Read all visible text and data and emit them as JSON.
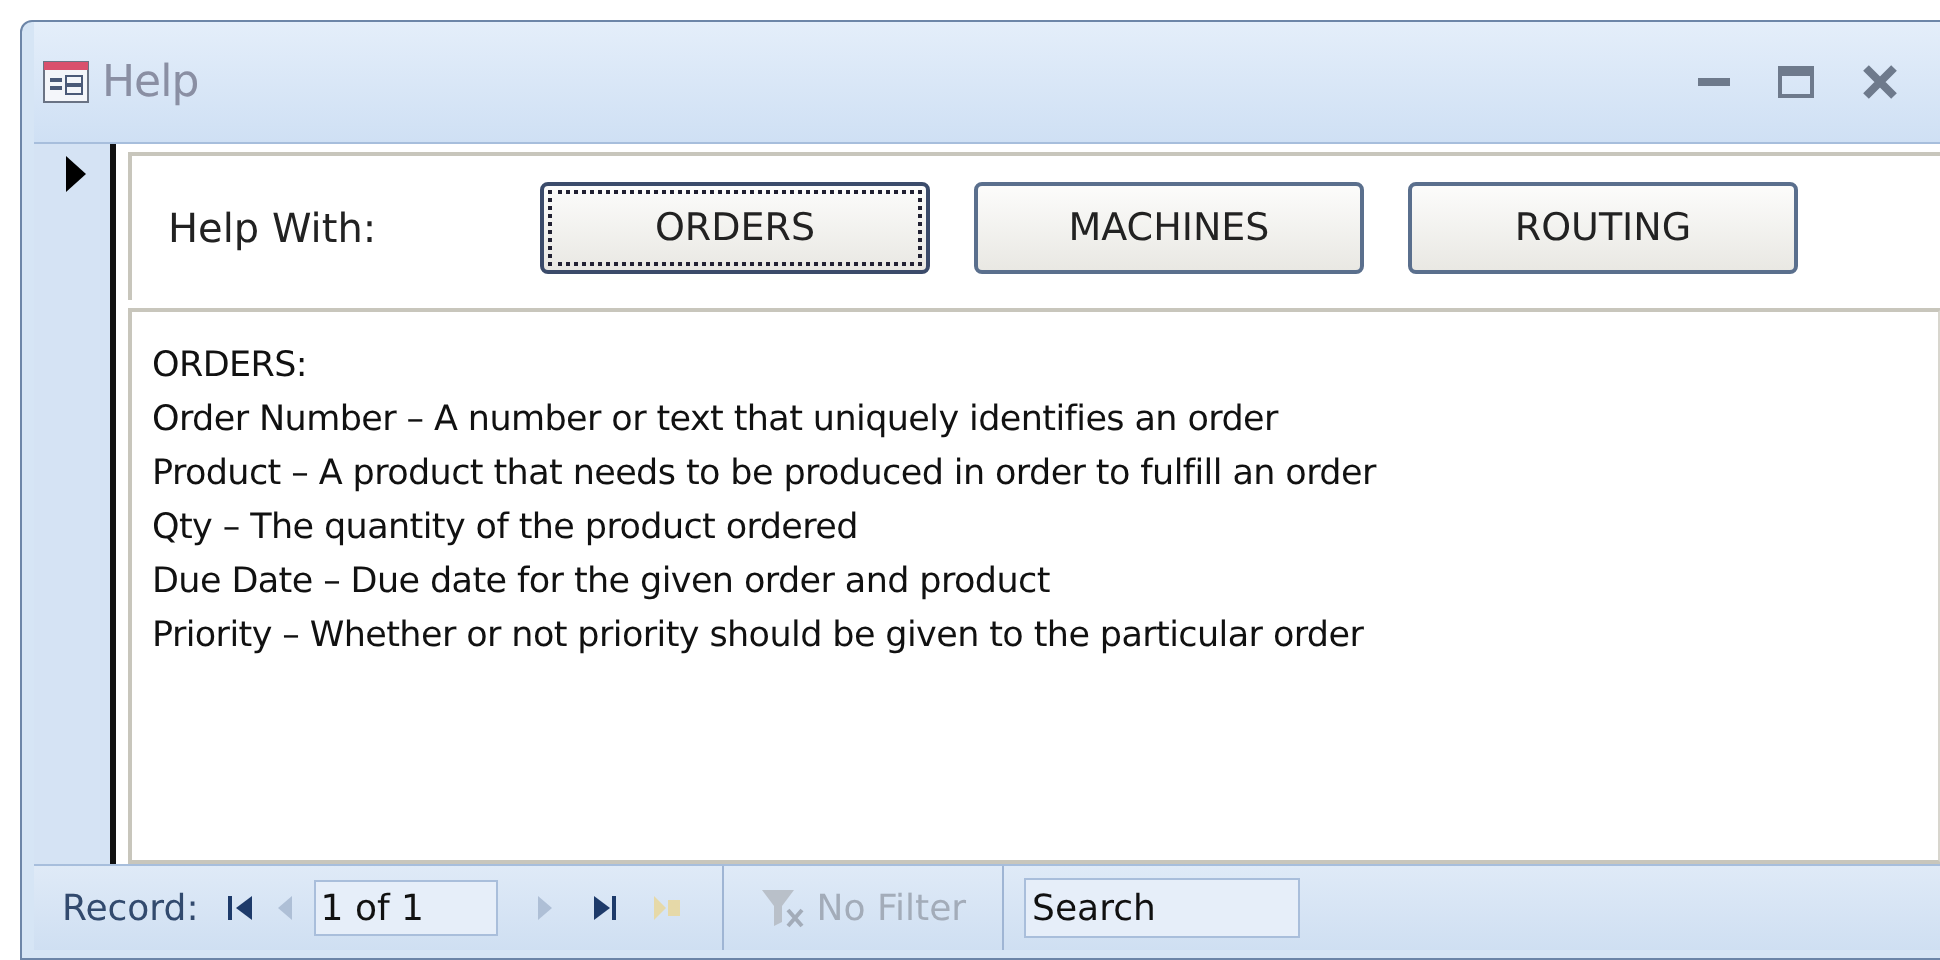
{
  "window": {
    "title": "Help"
  },
  "header": {
    "label": "Help With:",
    "buttons": [
      {
        "label": "ORDERS",
        "focused": true
      },
      {
        "label": "MACHINES",
        "focused": false
      },
      {
        "label": "ROUTING",
        "focused": false
      }
    ]
  },
  "detail": {
    "lines": [
      "ORDERS:",
      "Order Number – A number or text that uniquely identifies an order",
      "Product – A product that needs to be produced in order to fulfill an order",
      "Qty – The quantity of the product ordered",
      "Due Date – Due date for the given order and product",
      "Priority – Whether or not priority should be given to the particular order"
    ]
  },
  "status_bar": {
    "record_label": "Record:",
    "position": "1 of 1",
    "nav": [
      {
        "kind": "first",
        "disabled": false
      },
      {
        "kind": "prev",
        "disabled": true
      },
      {
        "kind": "next",
        "disabled": true
      },
      {
        "kind": "last",
        "disabled": false
      },
      {
        "kind": "new",
        "disabled": true
      }
    ],
    "filter": {
      "label": "No Filter",
      "disabled": true
    },
    "search": {
      "placeholder": "Search"
    }
  }
}
